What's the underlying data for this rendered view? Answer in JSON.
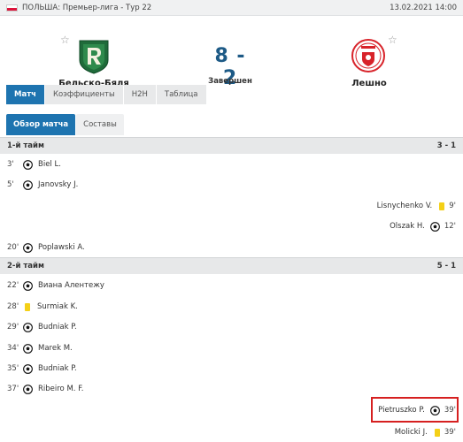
{
  "header": {
    "breadcrumb": "ПОЛЬША: Премьер-лига - Тур 22",
    "datetime": "13.02.2021 14:00"
  },
  "match": {
    "home_team": "Бельско-Бяля",
    "away_team": "Лешно",
    "score": "8 - 2",
    "status": "Завершен"
  },
  "main_tabs": [
    "Матч",
    "Коэффициенты",
    "H2H",
    "Таблица"
  ],
  "sub_tabs": [
    "Обзор матча",
    "Составы"
  ],
  "halves": [
    {
      "title": "1-й тайм",
      "score": "3 - 1",
      "events": [
        {
          "side": "home",
          "minute": "3'",
          "type": "goal",
          "player": "Biel L."
        },
        {
          "side": "home",
          "minute": "5'",
          "type": "goal",
          "player": "Janovsky J."
        },
        {
          "side": "away",
          "minute": "9'",
          "type": "yellow-card",
          "player": "Lisnychenko V."
        },
        {
          "side": "away",
          "minute": "12'",
          "type": "goal",
          "player": "Olszak H."
        },
        {
          "side": "home",
          "minute": "20'",
          "type": "goal",
          "player": "Poplawski A."
        }
      ]
    },
    {
      "title": "2-й тайм",
      "score": "5 - 1",
      "events": [
        {
          "side": "home",
          "minute": "22'",
          "type": "goal",
          "player": "Виана Алентежу"
        },
        {
          "side": "home",
          "minute": "28'",
          "type": "yellow-card",
          "player": "Surmiak K."
        },
        {
          "side": "home",
          "minute": "29'",
          "type": "goal",
          "player": "Budniak P."
        },
        {
          "side": "home",
          "minute": "34'",
          "type": "goal",
          "player": "Marek M."
        },
        {
          "side": "home",
          "minute": "35'",
          "type": "goal",
          "player": "Budniak P."
        },
        {
          "side": "home",
          "minute": "37'",
          "type": "goal",
          "player": "Ribeiro M. F."
        },
        {
          "side": "away",
          "minute": "39'",
          "type": "goal",
          "player": "Pietruszko P."
        },
        {
          "side": "away",
          "minute": "39'",
          "type": "yellow-card",
          "player": "Molicki J."
        }
      ]
    }
  ],
  "icons": {
    "goal": "soccer-ball-icon",
    "yellow_card": "yellow-card-icon",
    "favorite": "star-icon"
  },
  "colors": {
    "accent": "#1e74b0",
    "score": "#1d5a86",
    "yellow_card": "#f4d017",
    "highlight": "#d62020"
  }
}
